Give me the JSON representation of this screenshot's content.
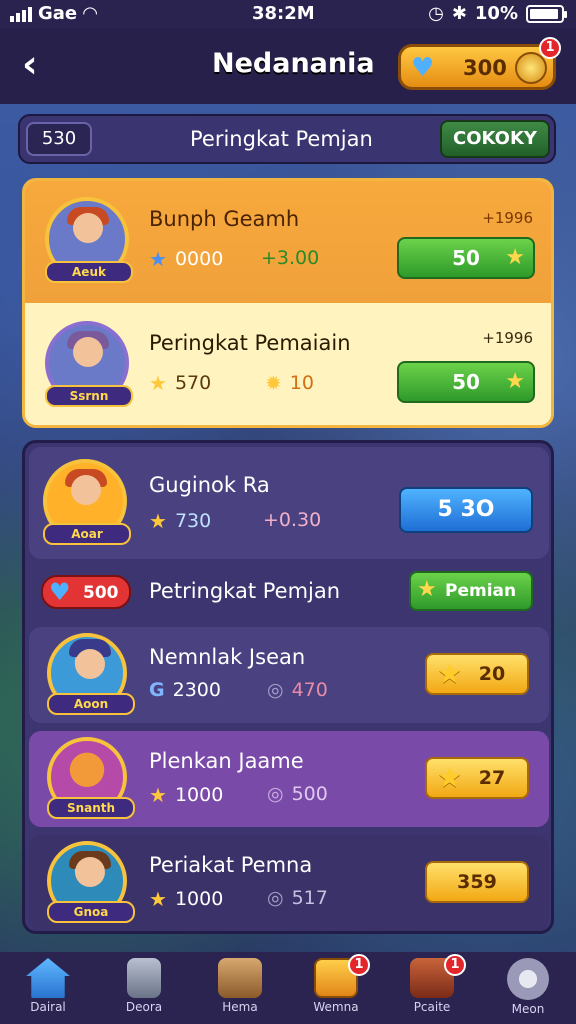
{
  "status_bar": {
    "carrier": "Gae",
    "time": "38:2M",
    "battery": "10%"
  },
  "header": {
    "title": "Nedanania",
    "coins": "300",
    "coin_badge": "1"
  },
  "subbar": {
    "count": "530",
    "label": "Peringkat Pemjan",
    "button": "COKOKY"
  },
  "cards": [
    {
      "name": "Bunph Geamh",
      "avatar_label": "Aeuk",
      "stat1": "0000",
      "stat2": "+3.00",
      "pct": "+1996",
      "button": "50"
    },
    {
      "name": "Peringkat Pemaiain",
      "avatar_label": "Ssrnn",
      "stat1": "570",
      "stat2": "10",
      "pct": "+1996",
      "button": "50"
    },
    {
      "name": "Guginok Ra",
      "avatar_label": "Aoar",
      "stat1": "730",
      "stat2": "+0.30",
      "button": "5 3O"
    },
    {
      "row_badge": "500",
      "row_label": "Petringkat Pemjan",
      "row_button": "Pemian"
    },
    {
      "name": "Nemnlak Jsean",
      "avatar_label": "Aoon",
      "stat1": "2300",
      "stat2": "470",
      "button": "20"
    },
    {
      "name": "Plenkan Jaame",
      "avatar_label": "Snanth",
      "stat1": "1000",
      "stat2": "500",
      "button": "27"
    },
    {
      "name": "Periakat Pemna",
      "avatar_label": "Gnoa",
      "stat1": "1000",
      "stat2": "517",
      "button": "359"
    }
  ],
  "nav": [
    {
      "label": "Dairal",
      "icon": "home-icon",
      "badge": ""
    },
    {
      "label": "Deora",
      "icon": "user-icon",
      "badge": ""
    },
    {
      "label": "Hema",
      "icon": "box-icon",
      "badge": ""
    },
    {
      "label": "Wemna",
      "icon": "gift-icon",
      "badge": "1"
    },
    {
      "label": "Pcaite",
      "icon": "chest-icon",
      "badge": "1"
    },
    {
      "label": "Meon",
      "icon": "settings-icon",
      "badge": ""
    }
  ]
}
